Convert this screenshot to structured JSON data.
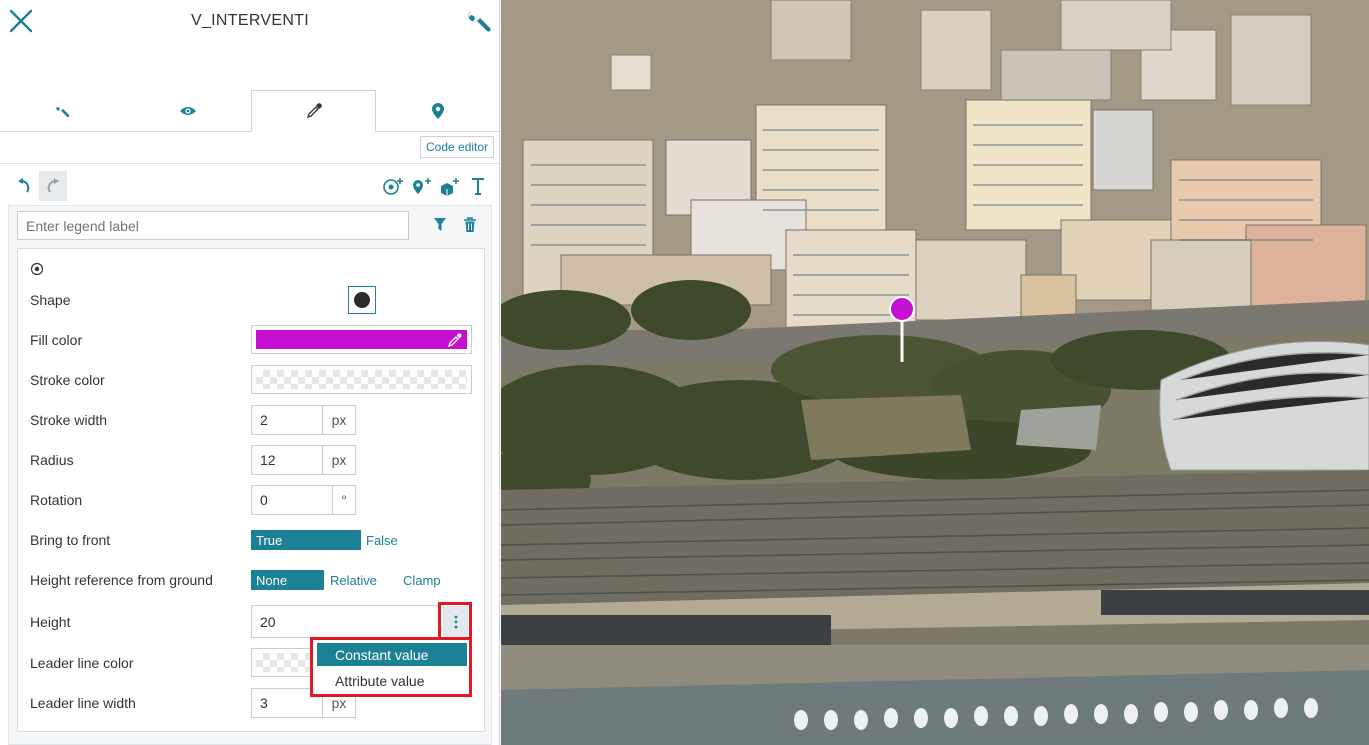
{
  "header": {
    "title": "V_INTERVENTI",
    "close_icon": "close-icon",
    "settings_icon": "wrench-icon"
  },
  "tabs": [
    {
      "icon": "wrench-icon",
      "active": false
    },
    {
      "icon": "eye-icon",
      "active": false
    },
    {
      "icon": "color-picker-icon",
      "active": true
    },
    {
      "icon": "map-marker-icon",
      "active": false
    }
  ],
  "code_editor_label": "Code editor",
  "toolbar": {
    "undo_icon": "undo-icon",
    "redo_icon": "redo-icon",
    "add_icons": [
      "add-circle-icon",
      "add-marker-icon",
      "add-model-icon",
      "add-text-icon"
    ]
  },
  "legend": {
    "placeholder": "Enter legend label",
    "filter_icon": "filter-icon",
    "delete_icon": "trash-icon"
  },
  "style": {
    "shape_label": "Shape",
    "fill_color_label": "Fill color",
    "fill_color": "#c50fd1",
    "stroke_color_label": "Stroke color",
    "stroke_width_label": "Stroke width",
    "stroke_width_value": "2",
    "stroke_width_unit": "px",
    "radius_label": "Radius",
    "radius_value": "12",
    "radius_unit": "px",
    "rotation_label": "Rotation",
    "rotation_value": "0",
    "rotation_unit": "°",
    "bring_to_front_label": "Bring to front",
    "bring_to_front_true": "True",
    "bring_to_front_false": "False",
    "height_ref_label": "Height reference from ground",
    "height_ref_none": "None",
    "height_ref_relative": "Relative",
    "height_ref_clamp": "Clamp",
    "height_label": "Height",
    "height_value": "20",
    "leader_color_label": "Leader line color",
    "leader_width_label": "Leader line width",
    "leader_width_value": "3",
    "leader_width_unit": "px"
  },
  "height_menu": {
    "options": [
      "Constant value",
      "Attribute value"
    ],
    "selected": "Constant value"
  },
  "accent_color": "#1d8196",
  "highlight_color": "#e01a24"
}
